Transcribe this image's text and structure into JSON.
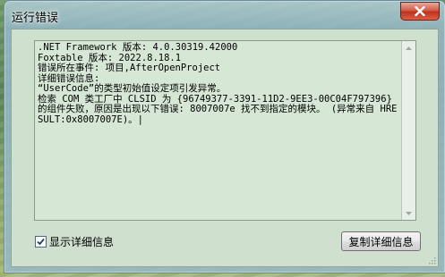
{
  "window": {
    "title": "运行错误"
  },
  "error_text": {
    "lines": [
      ".NET Framework 版本: 4.0.30319.42000",
      "Foxtable 版本: 2022.8.18.1",
      "错误所在事件: 项目,AfterOpenProject",
      "详细错误信息:",
      "“UserCode”的类型初始值设定项引发异常。",
      "检索 COM 类工厂中 CLSID 为 {96749377-3391-11D2-9EE3-00C04F797396} 的组件失败，原因是出现以下错误: 8007007e 找不到指定的模块。 (异常来自 HRESULT:0x8007007E)。|"
    ]
  },
  "show_details": {
    "label": "显示详细信息",
    "checked": true
  },
  "copy_button": {
    "label": "复制详细信息"
  },
  "icons": {
    "close": "close-icon",
    "scroll_up": "scroll-up-icon",
    "scroll_down": "scroll-down-icon",
    "check": "checkmark-icon"
  }
}
